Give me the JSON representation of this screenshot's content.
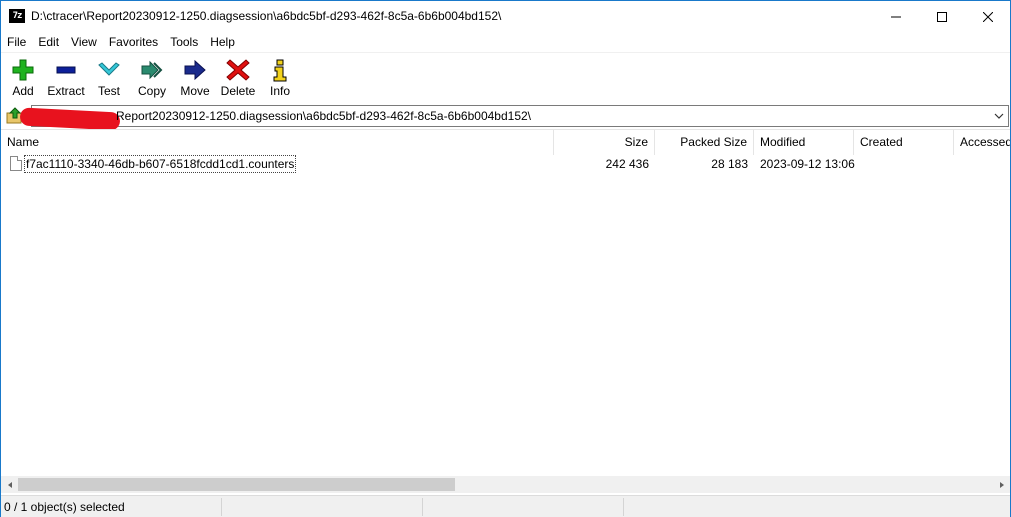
{
  "window": {
    "title": "D:\\ctracer\\Report20230912-1250.diagsession\\a6bdc5bf-d293-462f-8c5a-6b6b004bd152\\",
    "app_icon_text": "7z"
  },
  "menu": [
    "File",
    "Edit",
    "View",
    "Favorites",
    "Tools",
    "Help"
  ],
  "toolbar": {
    "add": "Add",
    "extract": "Extract",
    "test": "Test",
    "copy": "Copy",
    "move": "Move",
    "delete": "Delete",
    "info": "Info"
  },
  "address": {
    "visible_text": "Report20230912-1250.diagsession\\a6bdc5bf-d293-462f-8c5a-6b6b004bd152\\"
  },
  "columns": {
    "name": "Name",
    "size": "Size",
    "packed_size": "Packed Size",
    "modified": "Modified",
    "created": "Created",
    "accessed": "Accessed"
  },
  "files": [
    {
      "name": "f7ac1110-3340-46db-b607-6518fcdd1cd1.counters",
      "size": "242 436",
      "packed_size": "28 183",
      "modified": "2023-09-12 13:06",
      "created": "",
      "accessed": ""
    }
  ],
  "status": {
    "selection": "0 / 1 object(s) selected",
    "cell2": "",
    "cell3": "",
    "cell4": ""
  },
  "colors": {
    "add_green": "#1fb31f",
    "extract_blue": "#0d1f9a",
    "test_cyan": "#35c8d8",
    "copy_teal": "#2a8a6e",
    "move_navy": "#1a2a8c",
    "delete_red": "#e01010",
    "info_yellow": "#f2d21c",
    "redaction_red": "#e8121e"
  }
}
